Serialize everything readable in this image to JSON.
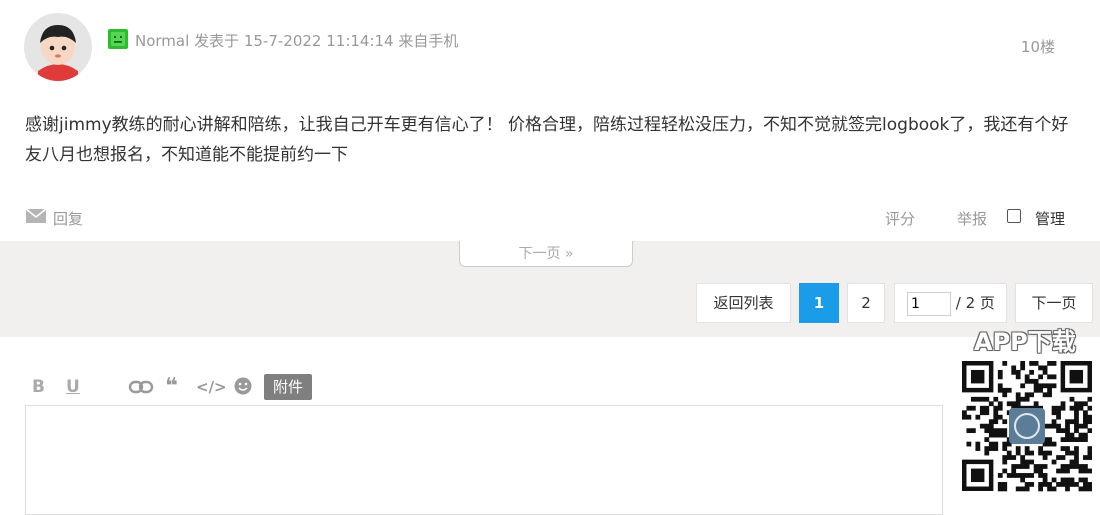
{
  "post": {
    "author": "Normal",
    "meta": "发表于 15-7-2022 11:14:14 来自手机",
    "floor": "10楼",
    "content": "感谢jimmy教练的耐心讲解和陪练，让我自己开车更有信心了！ 价格合理，陪练过程轻松没压力，不知不觉就签完logbook了，我还有个好友八月也想报名，不知道能不能提前约一下",
    "actions": {
      "reply": "回复",
      "rate": "评分",
      "report": "举报",
      "manage": "管理"
    }
  },
  "next_page_tab": "下一页 »",
  "pagination": {
    "back_to_list": "返回列表",
    "current_page": "1",
    "page_2": "2",
    "jump_value": "1",
    "total": " / 2 页",
    "next": "下一页"
  },
  "editor": {
    "bold": "B",
    "underline": "U",
    "quote": "❝",
    "code": "</>",
    "attach": "附件"
  },
  "app_download": {
    "title": "APP下载"
  },
  "colors": {
    "accent": "#1a9ce8",
    "level_icon": "#2bbd2b"
  }
}
